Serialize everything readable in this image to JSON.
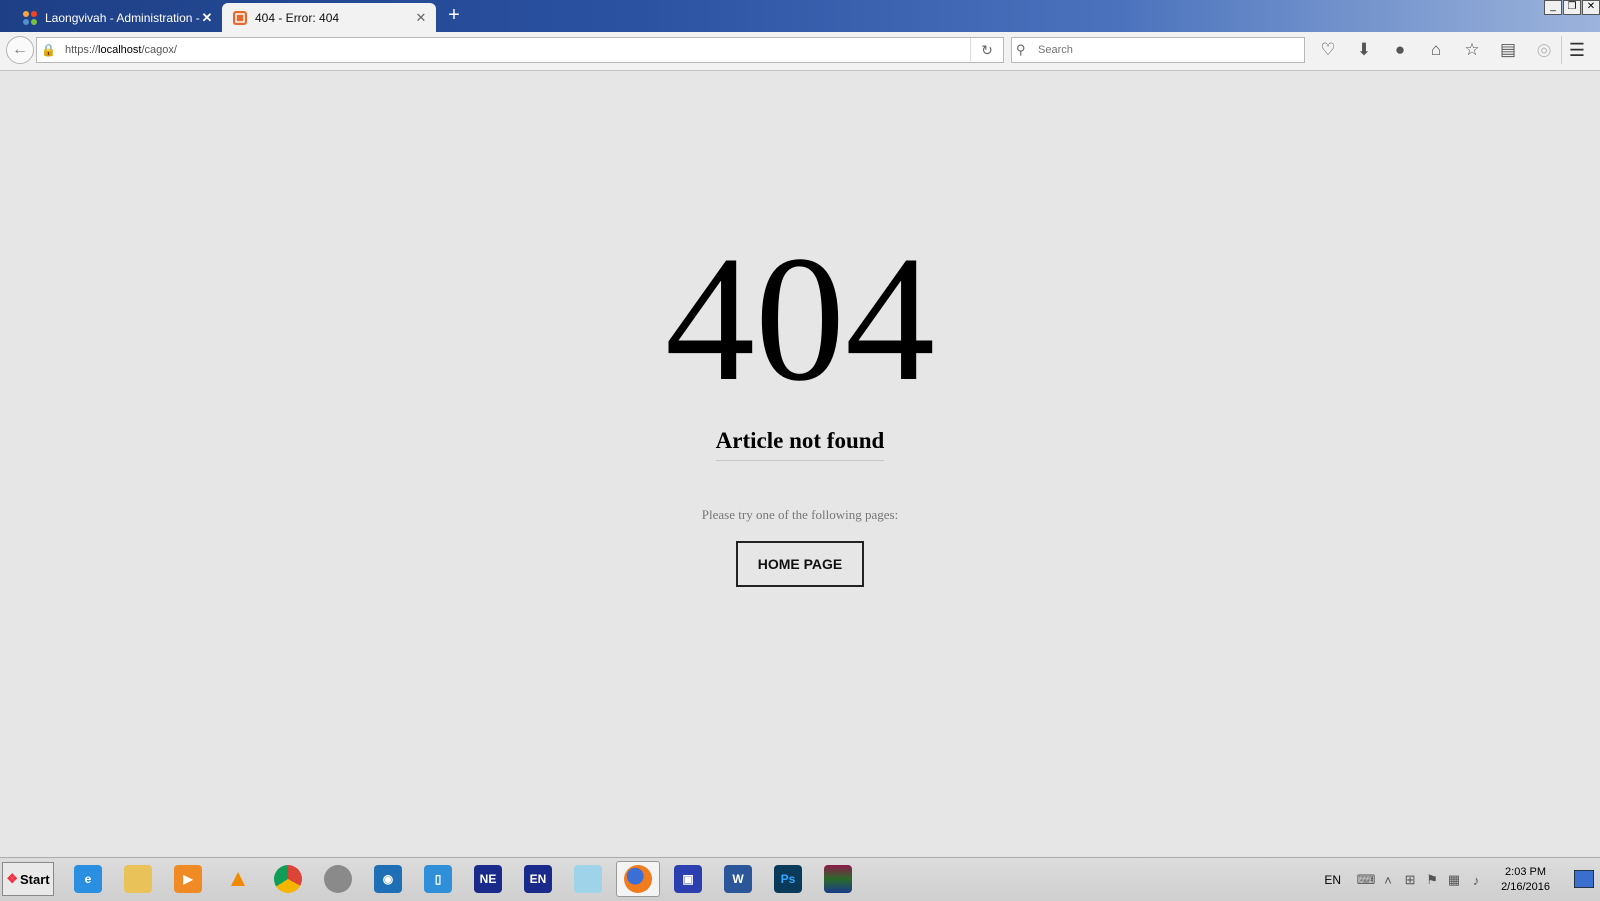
{
  "browser": {
    "tabs": [
      {
        "label": "Laongvivah - Administration - ...",
        "active": false,
        "favicon": "joomla-icon"
      },
      {
        "label": "404 - Error: 404",
        "active": true,
        "favicon": "error-page-icon"
      }
    ],
    "url_scheme": "https://",
    "url_host": "localhost",
    "url_path": "/cagox/",
    "search_placeholder": "Search",
    "toolbar_icons": [
      "pocket-icon",
      "download-icon",
      "chat-icon",
      "home-icon",
      "bookmark-star-icon",
      "reading-list-icon",
      "sync-icon"
    ]
  },
  "page": {
    "code": "404",
    "heading": "Article not found",
    "hint": "Please try one of the following pages:",
    "home_button": "HOME PAGE"
  },
  "taskbar": {
    "start_label": "Start",
    "apps": [
      "internet-explorer-icon",
      "file-explorer-icon",
      "media-player-icon",
      "vlc-icon",
      "chrome-icon",
      "app-portrait-icon",
      "camera-app-icon",
      "reader-app-icon",
      "ne-app-icon",
      "en-app-icon",
      "notepad-icon",
      "firefox-icon",
      "save-app-icon",
      "word-icon",
      "photoshop-icon",
      "winrar-icon"
    ],
    "language": "EN",
    "time": "2:03 PM",
    "date": "2/16/2016"
  },
  "colors": {
    "page_bg": "#e6e6e6",
    "tabstrip": "#2a52a1"
  }
}
